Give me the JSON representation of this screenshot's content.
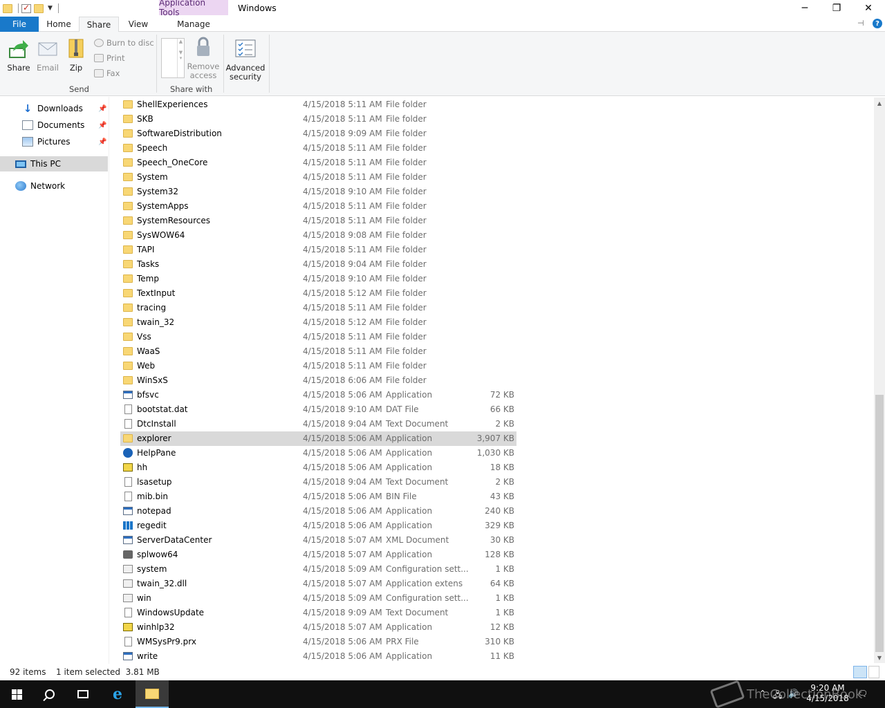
{
  "window": {
    "title": "Windows",
    "context_tab_group": "Application Tools"
  },
  "ribbon_tabs": {
    "file": "File",
    "home": "Home",
    "share": "Share",
    "view": "View",
    "manage": "Manage"
  },
  "ribbon": {
    "share": "Share",
    "email": "Email",
    "zip": "Zip",
    "burn": "Burn to disc",
    "print": "Print",
    "fax": "Fax",
    "send_group": "Send",
    "remove_access_1": "Remove",
    "remove_access_2": "access",
    "share_with_group": "Share with",
    "advanced_security_1": "Advanced",
    "advanced_security_2": "security"
  },
  "nav": {
    "downloads": "Downloads",
    "documents": "Documents",
    "pictures": "Pictures",
    "this_pc": "This PC",
    "network": "Network"
  },
  "files": [
    {
      "name": "ShellExperiences",
      "date": "4/15/2018 5:11 AM",
      "type": "File folder",
      "size": "",
      "icon": "folder"
    },
    {
      "name": "SKB",
      "date": "4/15/2018 5:11 AM",
      "type": "File folder",
      "size": "",
      "icon": "folder"
    },
    {
      "name": "SoftwareDistribution",
      "date": "4/15/2018 9:09 AM",
      "type": "File folder",
      "size": "",
      "icon": "folder"
    },
    {
      "name": "Speech",
      "date": "4/15/2018 5:11 AM",
      "type": "File folder",
      "size": "",
      "icon": "folder"
    },
    {
      "name": "Speech_OneCore",
      "date": "4/15/2018 5:11 AM",
      "type": "File folder",
      "size": "",
      "icon": "folder"
    },
    {
      "name": "System",
      "date": "4/15/2018 5:11 AM",
      "type": "File folder",
      "size": "",
      "icon": "folder"
    },
    {
      "name": "System32",
      "date": "4/15/2018 9:10 AM",
      "type": "File folder",
      "size": "",
      "icon": "folder"
    },
    {
      "name": "SystemApps",
      "date": "4/15/2018 5:11 AM",
      "type": "File folder",
      "size": "",
      "icon": "folder"
    },
    {
      "name": "SystemResources",
      "date": "4/15/2018 5:11 AM",
      "type": "File folder",
      "size": "",
      "icon": "folder"
    },
    {
      "name": "SysWOW64",
      "date": "4/15/2018 9:08 AM",
      "type": "File folder",
      "size": "",
      "icon": "folder"
    },
    {
      "name": "TAPI",
      "date": "4/15/2018 5:11 AM",
      "type": "File folder",
      "size": "",
      "icon": "folder"
    },
    {
      "name": "Tasks",
      "date": "4/15/2018 9:04 AM",
      "type": "File folder",
      "size": "",
      "icon": "folder"
    },
    {
      "name": "Temp",
      "date": "4/15/2018 9:10 AM",
      "type": "File folder",
      "size": "",
      "icon": "folder"
    },
    {
      "name": "TextInput",
      "date": "4/15/2018 5:12 AM",
      "type": "File folder",
      "size": "",
      "icon": "folder"
    },
    {
      "name": "tracing",
      "date": "4/15/2018 5:11 AM",
      "type": "File folder",
      "size": "",
      "icon": "folder"
    },
    {
      "name": "twain_32",
      "date": "4/15/2018 5:12 AM",
      "type": "File folder",
      "size": "",
      "icon": "folder"
    },
    {
      "name": "Vss",
      "date": "4/15/2018 5:11 AM",
      "type": "File folder",
      "size": "",
      "icon": "folder"
    },
    {
      "name": "WaaS",
      "date": "4/15/2018 5:11 AM",
      "type": "File folder",
      "size": "",
      "icon": "folder"
    },
    {
      "name": "Web",
      "date": "4/15/2018 5:11 AM",
      "type": "File folder",
      "size": "",
      "icon": "folder"
    },
    {
      "name": "WinSxS",
      "date": "4/15/2018 6:06 AM",
      "type": "File folder",
      "size": "",
      "icon": "folder"
    },
    {
      "name": "bfsvc",
      "date": "4/15/2018 5:06 AM",
      "type": "Application",
      "size": "72 KB",
      "icon": "app"
    },
    {
      "name": "bootstat.dat",
      "date": "4/15/2018 9:10 AM",
      "type": "DAT File",
      "size": "66 KB",
      "icon": "doc"
    },
    {
      "name": "DtcInstall",
      "date": "4/15/2018 9:04 AM",
      "type": "Text Document",
      "size": "2 KB",
      "icon": "doc"
    },
    {
      "name": "explorer",
      "date": "4/15/2018 5:06 AM",
      "type": "Application",
      "size": "3,907 KB",
      "icon": "folder",
      "selected": true
    },
    {
      "name": "HelpPane",
      "date": "4/15/2018 5:06 AM",
      "type": "Application",
      "size": "1,030 KB",
      "icon": "help"
    },
    {
      "name": "hh",
      "date": "4/15/2018 5:06 AM",
      "type": "Application",
      "size": "18 KB",
      "icon": "qhelp"
    },
    {
      "name": "lsasetup",
      "date": "4/15/2018 9:04 AM",
      "type": "Text Document",
      "size": "2 KB",
      "icon": "doc"
    },
    {
      "name": "mib.bin",
      "date": "4/15/2018 5:06 AM",
      "type": "BIN File",
      "size": "43 KB",
      "icon": "doc"
    },
    {
      "name": "notepad",
      "date": "4/15/2018 5:06 AM",
      "type": "Application",
      "size": "240 KB",
      "icon": "app"
    },
    {
      "name": "regedit",
      "date": "4/15/2018 5:06 AM",
      "type": "Application",
      "size": "329 KB",
      "icon": "grid"
    },
    {
      "name": "ServerDataCenter",
      "date": "4/15/2018 5:07 AM",
      "type": "XML Document",
      "size": "30 KB",
      "icon": "app"
    },
    {
      "name": "splwow64",
      "date": "4/15/2018 5:07 AM",
      "type": "Application",
      "size": "128 KB",
      "icon": "printer"
    },
    {
      "name": "system",
      "date": "4/15/2018 5:09 AM",
      "type": "Configuration sett...",
      "size": "1 KB",
      "icon": "gear"
    },
    {
      "name": "twain_32.dll",
      "date": "4/15/2018 5:07 AM",
      "type": "Application extens",
      "size": "64 KB",
      "icon": "gear"
    },
    {
      "name": "win",
      "date": "4/15/2018 5:09 AM",
      "type": "Configuration sett...",
      "size": "1 KB",
      "icon": "gear"
    },
    {
      "name": "WindowsUpdate",
      "date": "4/15/2018 9:09 AM",
      "type": "Text Document",
      "size": "1 KB",
      "icon": "doc"
    },
    {
      "name": "winhlp32",
      "date": "4/15/2018 5:07 AM",
      "type": "Application",
      "size": "12 KB",
      "icon": "qhelp"
    },
    {
      "name": "WMSysPr9.prx",
      "date": "4/15/2018 5:06 AM",
      "type": "PRX File",
      "size": "310 KB",
      "icon": "doc"
    },
    {
      "name": "write",
      "date": "4/15/2018 5:06 AM",
      "type": "Application",
      "size": "11 KB",
      "icon": "app"
    }
  ],
  "status": {
    "item_count": "92 items",
    "selection": "1 item selected  3.81 MB"
  },
  "taskbar": {
    "time": "9:20 AM",
    "date": "4/15/2018",
    "watermark": "TheCollectionBook"
  }
}
